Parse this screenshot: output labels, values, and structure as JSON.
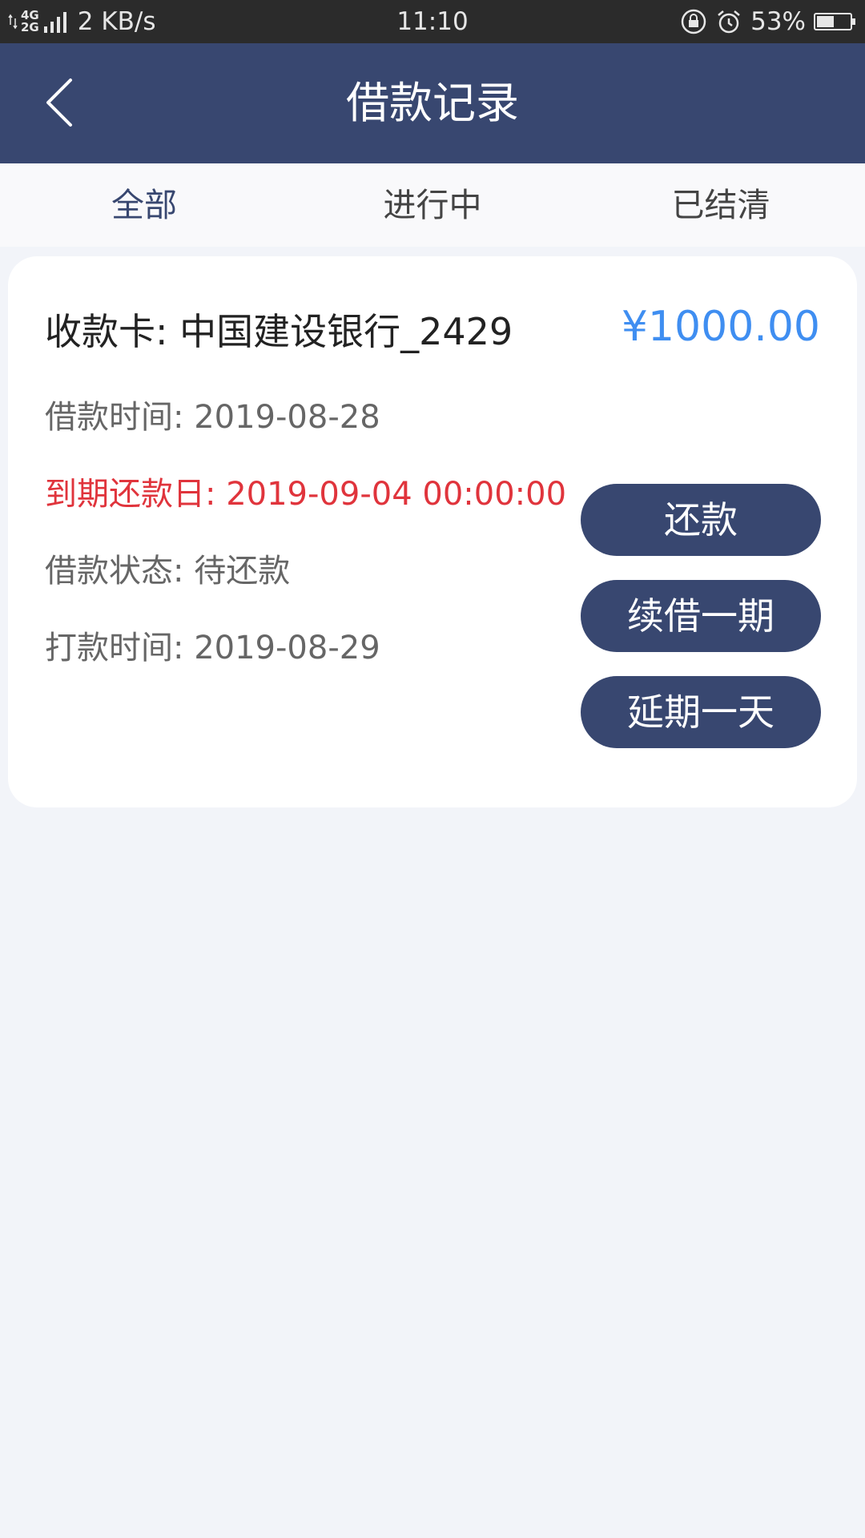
{
  "status_bar": {
    "network_4g": "4G",
    "network_2g": "2G",
    "speed": "2 KB/s",
    "time": "11:10",
    "battery": "53%",
    "battery_level": 0.53
  },
  "header": {
    "title": "借款记录"
  },
  "tabs": [
    {
      "label": "全部",
      "active": true
    },
    {
      "label": "进行中",
      "active": false
    },
    {
      "label": "已结清",
      "active": false
    }
  ],
  "loan_card": {
    "title": "收款卡: 中国建设银行_2429",
    "amount": "¥1000.00",
    "loan_time": "借款时间: 2019-08-28",
    "due_date": "到期还款日: 2019-09-04 00:00:00",
    "status": "借款状态: 待还款",
    "payout_time": "打款时间: 2019-08-29",
    "buttons": {
      "repay": "还款",
      "renew": "续借一期",
      "extend": "延期一天"
    }
  },
  "colors": {
    "header_bg": "#384770",
    "amount": "#3f8ef1",
    "due_date": "#e0343c",
    "page_bg": "#f2f4f9"
  }
}
